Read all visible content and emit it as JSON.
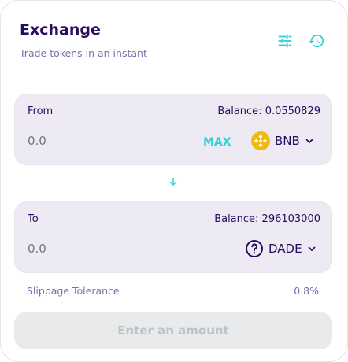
{
  "header": {
    "title": "Exchange",
    "subtitle": "Trade tokens in an instant",
    "settings_icon": "sliders-icon",
    "history_icon": "history-icon"
  },
  "from": {
    "label": "From",
    "balance": "Balance: 0.0550829",
    "amount_placeholder": "0.0",
    "max_label": "MAX",
    "token": "BNB",
    "token_icon": "bnb-logo-icon"
  },
  "switch_icon": "arrow-down-icon",
  "to": {
    "label": "To",
    "balance": "Balance: 296103000",
    "amount_placeholder": "0.0",
    "token": "DADE",
    "token_icon": "unknown-token-icon"
  },
  "slippage": {
    "label": "Slippage Tolerance",
    "value": "0.8%"
  },
  "submit_label": "Enter an amount",
  "colors": {
    "primary_text": "#280d5f",
    "secondary_text": "#7a6eaa",
    "accent": "#31d0d8",
    "panel_bg": "#eeeaf4",
    "bnb_yellow": "#f0b90b"
  }
}
